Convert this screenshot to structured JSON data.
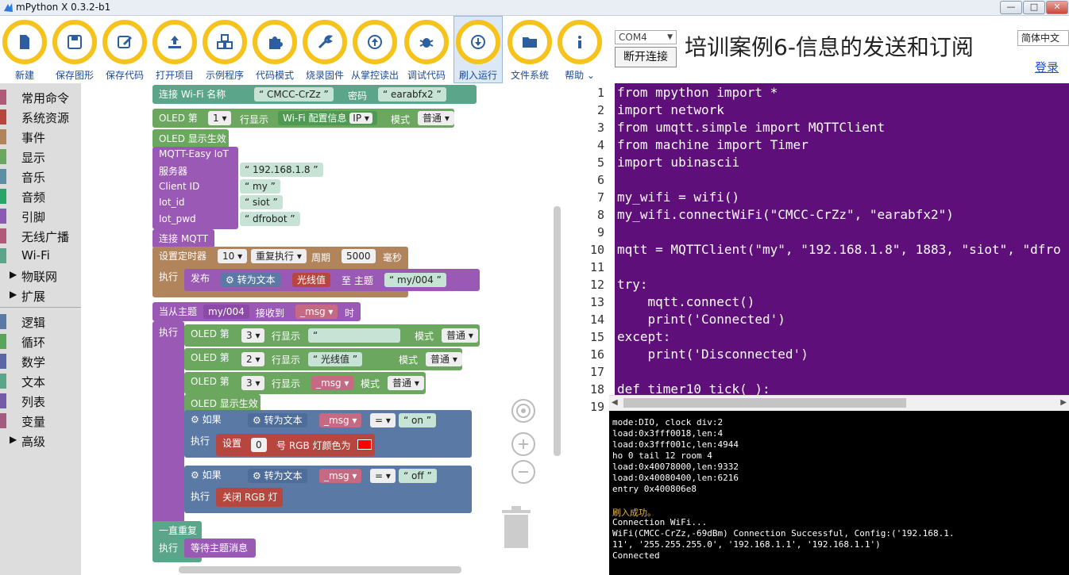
{
  "window": {
    "title": "mPython X 0.3.2-b1",
    "minimize": "—",
    "maximize": "□",
    "close": "✕"
  },
  "toolbar": [
    {
      "label": "新建",
      "icon": "file-icon"
    },
    {
      "label": "保存图形",
      "icon": "floppy-icon"
    },
    {
      "label": "保存代码",
      "icon": "edit-icon"
    },
    {
      "label": "打开项目",
      "icon": "upload-icon"
    },
    {
      "label": "示例程序",
      "icon": "cubes-icon"
    },
    {
      "label": "代码模式",
      "icon": "puzzle-icon"
    },
    {
      "label": "烧录固件",
      "icon": "wrench-icon"
    },
    {
      "label": "从掌控读出",
      "icon": "arrow-up-circle-icon"
    },
    {
      "label": "调试代码",
      "icon": "bug-icon"
    },
    {
      "label": "刷入运行",
      "icon": "arrow-down-circle-icon"
    },
    {
      "label": "文件系统",
      "icon": "folder-icon"
    },
    {
      "label": "帮助 ⌄",
      "icon": "info-icon"
    }
  ],
  "header": {
    "port": "COM4",
    "disconnect": "断开连接",
    "title": "培训案例6-信息的发送和订阅",
    "language": "简体中文",
    "login": "登录"
  },
  "categories": [
    {
      "label": "常用命令",
      "color": "#b05a7a"
    },
    {
      "label": "系统资源",
      "color": "#b7463f"
    },
    {
      "label": "事件",
      "color": "#b1845b"
    },
    {
      "label": "显示",
      "color": "#6ca75f"
    },
    {
      "label": "音乐",
      "color": "#5b8fa5"
    },
    {
      "label": "音频",
      "color": "#2aa56a"
    },
    {
      "label": "引脚",
      "color": "#8a5bb0"
    },
    {
      "label": "无线广播",
      "color": "#b05a7a"
    },
    {
      "label": "Wi-Fi",
      "color": "#5ba58a"
    },
    {
      "label": "物联网",
      "arrow": "▶"
    },
    {
      "label": "扩展",
      "arrow": "▶"
    },
    {
      "label": "逻辑",
      "color": "#5b79a5"
    },
    {
      "label": "循环",
      "color": "#5ba55b"
    },
    {
      "label": "数学",
      "color": "#5b67a5"
    },
    {
      "label": "文本",
      "color": "#5ba58a"
    },
    {
      "label": "列表",
      "color": "#745ba5"
    },
    {
      "label": "变量",
      "color": "#a55b80"
    },
    {
      "label": "高级",
      "arrow": "▶"
    }
  ],
  "blocks": {
    "wifi": {
      "label": "连接 Wi-Fi 名称",
      "ssid": "CMCC-CrZz",
      "pwd_label": "密码",
      "pwd": "earabfx2"
    },
    "oled1": {
      "label": "OLED 第",
      "line": "1 ▾",
      "show": "行显示",
      "info": "Wi-Fi 配置信息",
      "ip": "IP ▾",
      "mode": "模式",
      "mode_val": "普通 ▾"
    },
    "oled_show": "OLED 显示生效",
    "mqtt": {
      "title": "MQTT-Easy IoT",
      "server_label": "服务器",
      "server": "192.168.1.8",
      "client_label": "Client ID",
      "client": "my",
      "iot_id_label": "Iot_id",
      "iot_id": "siot",
      "iot_pwd_label": "Iot_pwd",
      "iot_pwd": "dfrobot",
      "connect": "连接 MQTT"
    },
    "timer": {
      "label": "设置定时器",
      "num": "10 ▾",
      "repeat": "重复执行 ▾",
      "period": "周期",
      "ms": "5000",
      "unit": "毫秒",
      "exec": "执行"
    },
    "publish": {
      "label": "发布",
      "to_text": "转为文本",
      "var": "光线值",
      "to": "至 主题",
      "topic": "my/004"
    },
    "on_msg": {
      "label": "当从主题",
      "topic": "my/004",
      "recv": "接收到",
      "var": "_msg ▾",
      "when": "时",
      "exec": "执行"
    },
    "oled3a": {
      "label": "OLED 第",
      "line": "3 ▾",
      "show": "行显示",
      "text": "",
      "mode": "模式",
      "mode_val": "普通 ▾"
    },
    "oled2": {
      "label": "OLED 第",
      "line": "2 ▾",
      "show": "行显示",
      "text": "光线值",
      "mode": "模式",
      "mode_val": "普通 ▾"
    },
    "oled3b": {
      "label": "OLED 第",
      "line": "3 ▾",
      "show": "行显示",
      "var": "_msg ▾",
      "mode": "模式",
      "mode_val": "普通 ▾"
    },
    "if1": {
      "label": "如果",
      "to_text": "转为文本",
      "var": "_msg ▾",
      "op": "= ▾",
      "val": "on",
      "exec": "执行",
      "set": "设置",
      "idx": "0",
      "rgb": "号 RGB 灯颜色为"
    },
    "if2": {
      "label": "如果",
      "to_text": "转为文本",
      "var": "_msg ▾",
      "op": "= ▾",
      "val": "off",
      "exec": "执行",
      "close": "关闭 RGB 灯"
    },
    "loop": {
      "label": "一直重复",
      "exec": "执行",
      "wait": "等待主题消息"
    }
  },
  "code": [
    "from mpython import *",
    "import network",
    "from umqtt.simple import MQTTClient",
    "from machine import Timer",
    "import ubinascii",
    "",
    "my_wifi = wifi()",
    "my_wifi.connectWiFi(\"CMCC-CrZz\", \"earabfx2\")",
    "",
    "mqtt = MQTTClient(\"my\", \"192.168.1.8\", 1883, \"siot\", \"dfro",
    "",
    "try:",
    "    mqtt.connect()",
    "    print('Connected')",
    "except:",
    "    print('Disconnected')",
    "",
    "def timer10_tick(_):",
    ""
  ],
  "line_numbers": [
    "1",
    "2",
    "3",
    "4",
    "5",
    "6",
    "7",
    "8",
    "9",
    "10",
    "11",
    "12",
    "13",
    "14",
    "15",
    "16",
    "17",
    "18",
    "19"
  ],
  "console": [
    "mode:DIO, clock div:2",
    "load:0x3fff0018,len:4",
    "load:0x3fff001c,len:4944",
    "ho 0 tail 12 room 4",
    "load:0x40078000,len:9332",
    "load:0x40080400,len:6216",
    "entry 0x400806e8",
    "",
    "刷入成功。",
    "Connection WiFi...",
    "WiFi(CMCC-CrZz,-69dBm) Connection Successful, Config:('192.168.1.",
    "11', '255.255.255.0', '192.168.1.1', '192.168.1.1')",
    "Connected"
  ]
}
